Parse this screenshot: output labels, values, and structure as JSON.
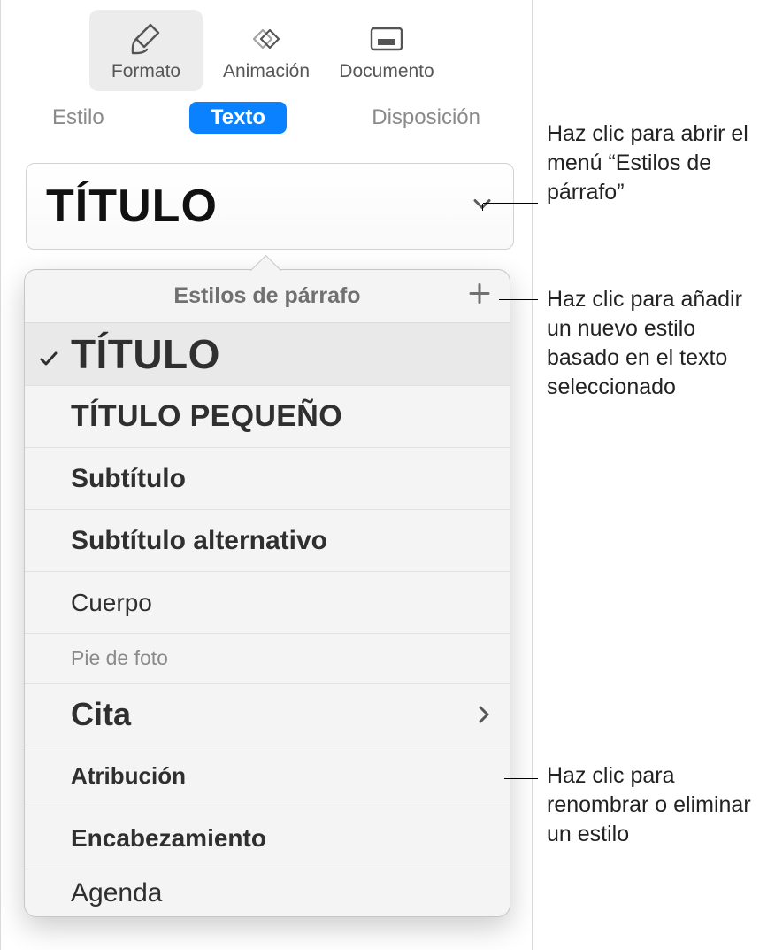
{
  "toolbar": {
    "format": "Formato",
    "animation": "Animación",
    "document": "Documento"
  },
  "subtabs": {
    "style": "Estilo",
    "text": "Texto",
    "layout": "Disposición"
  },
  "style_selector": {
    "current": "TÍTULO"
  },
  "popover": {
    "header": "Estilos de párrafo",
    "items": [
      {
        "label": "TÍTULO",
        "class": "st-titulo",
        "selected": true,
        "disclosure": false
      },
      {
        "label": "TÍTULO PEQUEÑO",
        "class": "st-titulop",
        "selected": false,
        "disclosure": false
      },
      {
        "label": "Subtítulo",
        "class": "st-subt",
        "selected": false,
        "disclosure": false
      },
      {
        "label": "Subtítulo alternativo",
        "class": "st-suba",
        "selected": false,
        "disclosure": false
      },
      {
        "label": "Cuerpo",
        "class": "st-cuerpo",
        "selected": false,
        "disclosure": false
      },
      {
        "label": "Pie de foto",
        "class": "st-pie",
        "selected": false,
        "disclosure": false
      },
      {
        "label": "Cita",
        "class": "st-cita",
        "selected": false,
        "disclosure": true
      },
      {
        "label": "Atribución",
        "class": "st-attr",
        "selected": false,
        "disclosure": false
      },
      {
        "label": "Encabezamiento",
        "class": "st-enc",
        "selected": false,
        "disclosure": false
      },
      {
        "label": "Agenda",
        "class": "st-agenda",
        "selected": false,
        "disclosure": false
      }
    ]
  },
  "annotations": {
    "a1": "Haz clic para abrir el menú “Estilos de párrafo”",
    "a2": "Haz clic para añadir un nuevo estilo basado en el texto seleccionado",
    "a3": "Haz clic para renombrar o eliminar un estilo"
  }
}
